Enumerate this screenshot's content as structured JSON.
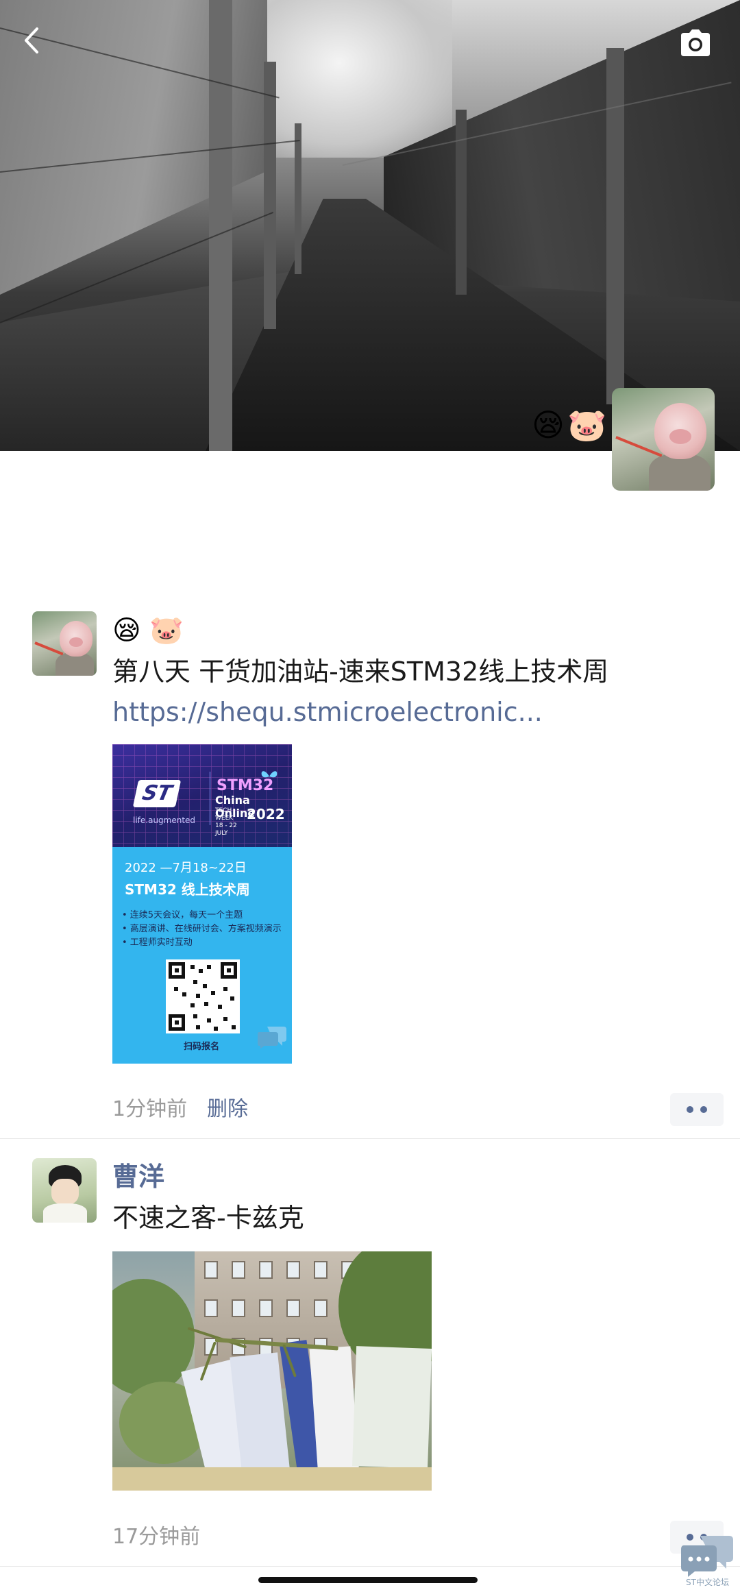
{
  "cover": {
    "emoji": [
      "😪",
      "🐷"
    ]
  },
  "posts": [
    {
      "emoji": [
        "😪",
        "🐷"
      ],
      "text": "第八天  干货加油站-速来STM32线上技术周",
      "link": "https://shequ.stmicroelectronic...",
      "time": "1分钟前",
      "delete_label": "删除",
      "poster": {
        "logo": "ST",
        "tagline": "life.augmented",
        "brand": "STM32",
        "event": "China Online",
        "week_label": "TECH WEEK",
        "week_dates": "18 - 22 JULY",
        "year": "2022",
        "date_range": "2022 —7月18~22日",
        "title": "STM32 线上技术周",
        "bullets": [
          "• 连续5天会议，每天一个主题",
          "• 高层演讲、在线研讨会、方案视频演示",
          "• 工程师实时互动"
        ],
        "scan_label": "扫码报名"
      }
    },
    {
      "author": "曹洋",
      "text": "不速之客-卡兹克",
      "time": "17分钟前"
    }
  ],
  "watermark": {
    "text": "ST中文论坛"
  },
  "colors": {
    "link": "#576b95",
    "meta": "#9a9a9a",
    "poster_blue": "#33b5ee"
  }
}
